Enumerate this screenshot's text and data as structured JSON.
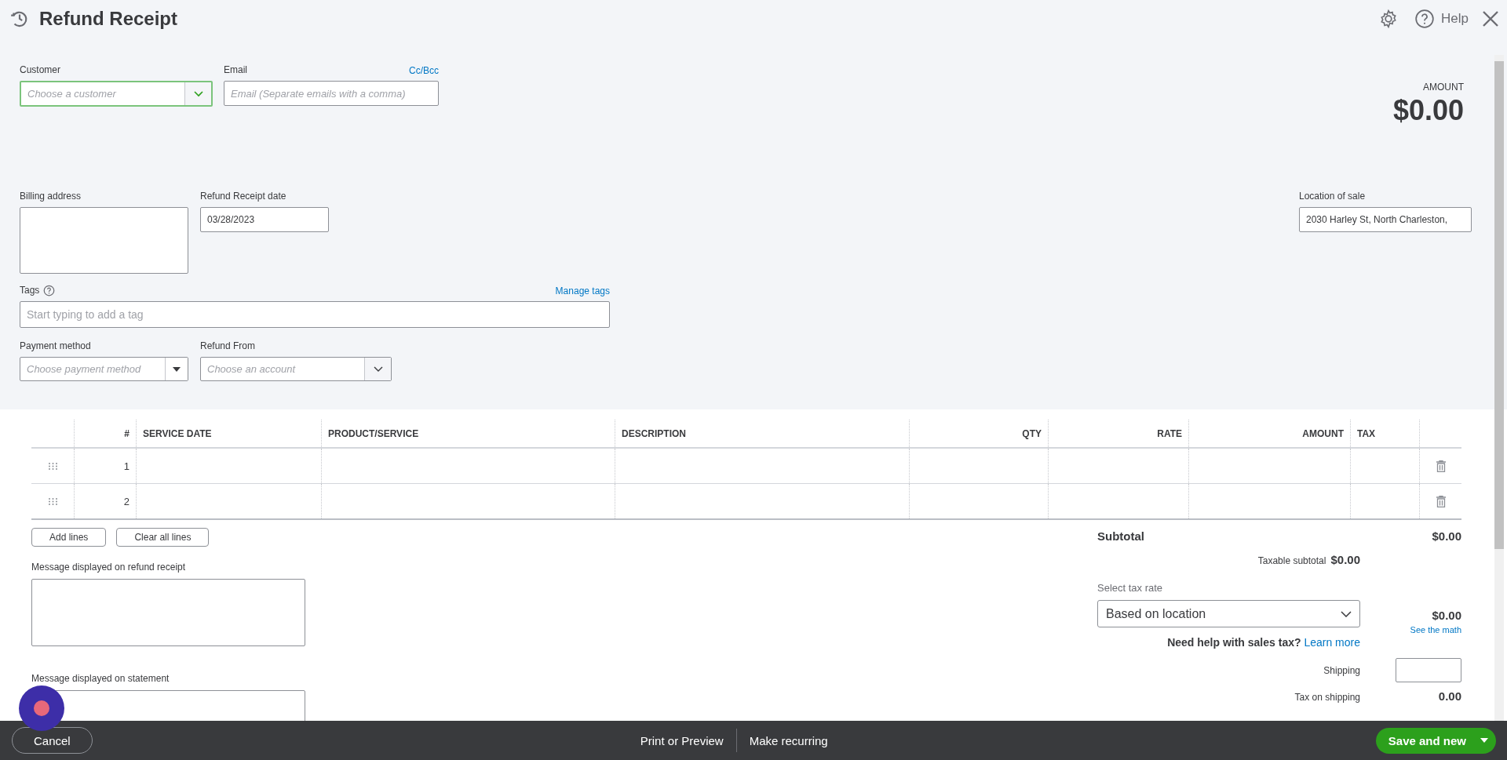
{
  "header": {
    "title": "Refund Receipt",
    "help": "Help"
  },
  "customer": {
    "label": "Customer",
    "placeholder": "Choose a customer"
  },
  "email": {
    "label": "Email",
    "link": "Cc/Bcc",
    "placeholder": "Email (Separate emails with a comma)"
  },
  "amount": {
    "label": "AMOUNT",
    "value": "$0.00"
  },
  "billing_address": {
    "label": "Billing address"
  },
  "receipt_date": {
    "label": "Refund Receipt date",
    "value": "03/28/2023"
  },
  "location": {
    "label": "Location of sale",
    "value": "2030 Harley St, North Charleston,"
  },
  "tags": {
    "label": "Tags",
    "link": "Manage tags",
    "placeholder": "Start typing to add a tag"
  },
  "payment_method": {
    "label": "Payment method",
    "placeholder": "Choose payment method"
  },
  "refund_from": {
    "label": "Refund From",
    "placeholder": "Choose an account"
  },
  "table": {
    "columns": [
      "#",
      "SERVICE DATE",
      "PRODUCT/SERVICE",
      "DESCRIPTION",
      "QTY",
      "RATE",
      "AMOUNT",
      "TAX"
    ],
    "rows": [
      {
        "number": "1"
      },
      {
        "number": "2"
      }
    ]
  },
  "line_buttons": [
    "Add lines",
    "Clear all lines"
  ],
  "messages": [
    {
      "label": "Message displayed on refund receipt"
    },
    {
      "label": "Message displayed on statement"
    }
  ],
  "totals": {
    "subtotal_label": "Subtotal",
    "subtotal": "$0.00",
    "taxable_label": "Taxable subtotal",
    "taxable": "$0.00",
    "tax_rate_label": "Select tax rate",
    "tax_rate": "Based on location",
    "tax": "$0.00",
    "see_math": "See the math",
    "help_text": "Need help with sales tax?",
    "learn_more": "Learn more",
    "shipping_label": "Shipping",
    "tax_shipping_label": "Tax on shipping",
    "tax_shipping": "0.00"
  },
  "footer": {
    "cancel": "Cancel",
    "print": "Print or Preview",
    "recurring": "Make recurring",
    "save": "Save and new"
  }
}
